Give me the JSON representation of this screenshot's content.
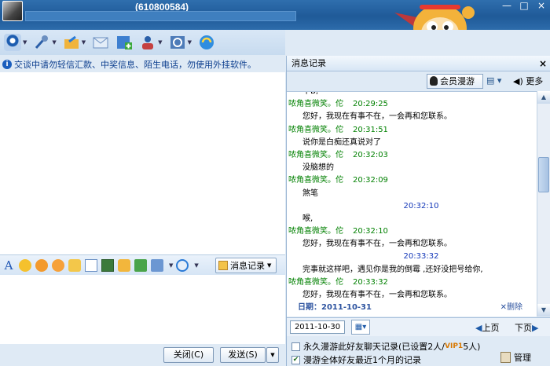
{
  "window": {
    "contact_number": "(610800584)",
    "controls": [
      "—",
      "□",
      "×"
    ]
  },
  "warning": {
    "text": "交谈中请勿轻信汇款、中奖信息、陌生电话，勿使用外挂软件。"
  },
  "input_toolbar": {
    "font_label": "A",
    "history_label": "消息记录"
  },
  "bottom": {
    "close_label": "关闭(C)",
    "send_label": "发送(S)"
  },
  "history": {
    "title": "消息记录",
    "close_label": "×",
    "vip_roam_label": "会员漫游",
    "more_label": "更多",
    "partial_top": "牛B,",
    "messages": [
      {
        "type": "msg",
        "name": "哝角喜微笑。佗",
        "time": "20:29:25",
        "text": "您好，我现在有事不在，一会再和您联系。"
      },
      {
        "type": "msg",
        "name": "哝角喜微笑。佗",
        "time": "20:31:51",
        "text": "说你是白痴还真说对了"
      },
      {
        "type": "msg",
        "name": "哝角喜微笑。佗",
        "time": "20:32:03",
        "text": "没脑想的"
      },
      {
        "type": "msg",
        "name": "哝角喜微笑。佗",
        "time": "20:32:09",
        "text": "煞笔"
      },
      {
        "type": "own",
        "time": "20:32:10",
        "text": "喉,"
      },
      {
        "type": "msg",
        "name": "哝角喜微笑。佗",
        "time": "20:32:10",
        "text": "您好，我现在有事不在，一会再和您联系。"
      },
      {
        "type": "own",
        "time": "20:33:32",
        "text": "完事就这样吧，遇见你是我的倒霉 ,还好没把号给你,"
      },
      {
        "type": "msg",
        "name": "哝角喜微笑。佗",
        "time": "20:33:32",
        "text": "您好，我现在有事不在，一会再和您联系。"
      }
    ],
    "date_label": "日期：2011-10-31",
    "delete_label": "删除",
    "current_date": "2011-10-30",
    "prev_label": "上页",
    "next_label": "下页",
    "option1_text": "永久漫游此好友聊天记录(已设置2人/",
    "option1_vip": "VIP1",
    "option1_tail": "5人)",
    "option2_text": "漫游全体好友最近1个月的记录",
    "option2_checked": true,
    "manage_label": "管理"
  }
}
